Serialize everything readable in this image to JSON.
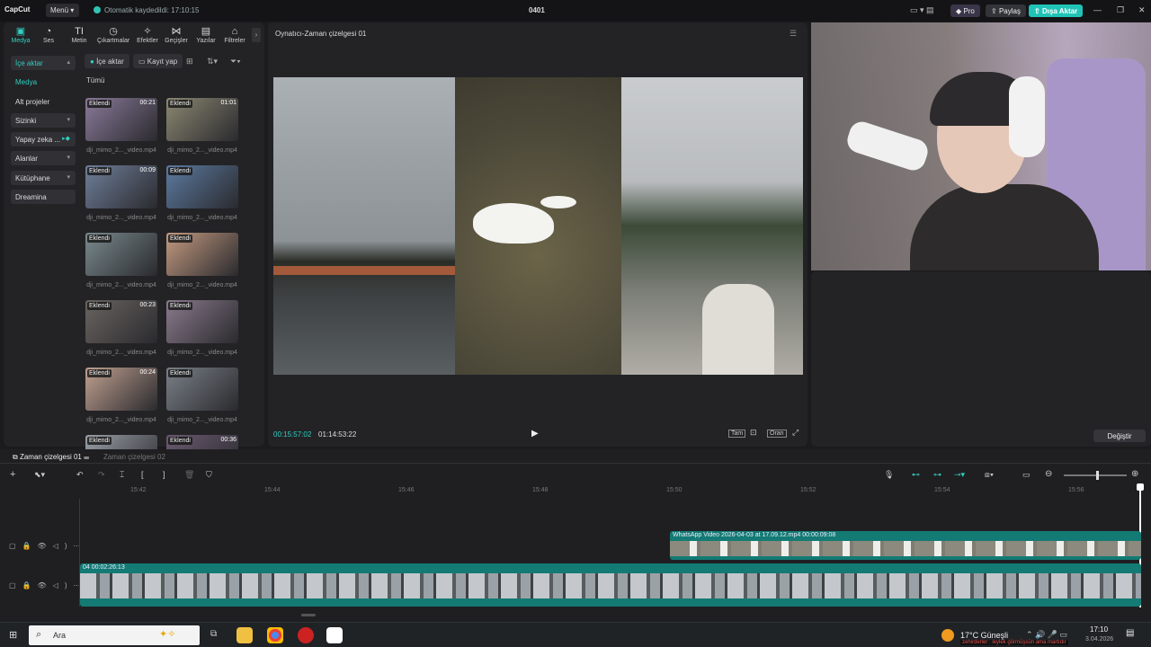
{
  "app": {
    "logo": "CapCut",
    "menu": "Menü",
    "autosave": "Otomatik kaydedildi: 17:10:15",
    "project": "0401",
    "pro": "Pro",
    "share": "Paylaş",
    "export": "Dışa Aktar"
  },
  "toolbar": [
    "Medya",
    "Ses",
    "Metin",
    "Çıkartmalar",
    "Efektler",
    "Geçişler",
    "Yazılar",
    "Filtreler"
  ],
  "sidebar": [
    "İçe aktar",
    "Medya",
    "Alt projeler",
    "Sizinki",
    "Yapay zeka ...",
    "Alanlar",
    "Kütüphane",
    "Dreamina"
  ],
  "media": {
    "import": "İçe aktar",
    "record": "Kayıt yap",
    "filter": "Tümü",
    "added": "Eklendi",
    "items": [
      {
        "dur": "00:21",
        "name": "dji_mimo_2..._video.mp4"
      },
      {
        "dur": "01:01",
        "name": "dji_mimo_2..._video.mp4"
      },
      {
        "dur": "00:09",
        "name": "dji_mimo_2..._video.mp4"
      },
      {
        "dur": "",
        "name": "dji_mimo_2..._video.mp4"
      },
      {
        "dur": "",
        "name": "dji_mimo_2..._video.mp4"
      },
      {
        "dur": "",
        "name": "dji_mimo_2..._video.mp4"
      },
      {
        "dur": "00:23",
        "name": "dji_mimo_2..._video.mp4"
      },
      {
        "dur": "",
        "name": "dji_mimo_2..._video.mp4"
      },
      {
        "dur": "00:24",
        "name": "dji_mimo_2..._video.mp4"
      },
      {
        "dur": "",
        "name": "dji_mimo_2..._video.mp4"
      },
      {
        "dur": "",
        "name": ""
      },
      {
        "dur": "00:36",
        "name": ""
      }
    ]
  },
  "player": {
    "title": "Oynatıcı-Zaman çizelgesi 01",
    "current": "00:15:57:02",
    "total": "01:14:53:22",
    "full": "Tam",
    "ratio": "Oran"
  },
  "props": {
    "change": "Değiştir"
  },
  "timeline": {
    "tab1": "Zaman çizelgesi 01",
    "tab2": "Zaman çizelgesi 02",
    "ticks": [
      "15:42",
      "15:44",
      "15:46",
      "15:48",
      "15:50",
      "15:52",
      "15:54",
      "15:56"
    ],
    "clip1": "WhatsApp Video 2026-04-03 at 17.09.12.mp4  00:00:09:08",
    "clip2": "04  00:02:26:13"
  },
  "taskbar": {
    "search": "Ara",
    "weather": "17°C  Güneşli",
    "time": "17:10",
    "date": "3.04.2026",
    "chat": "zehirderler : leylek görmüşsün ama martıdır"
  },
  "colors": {
    "accent": "#2fd0c0",
    "clip": "#137a74"
  }
}
